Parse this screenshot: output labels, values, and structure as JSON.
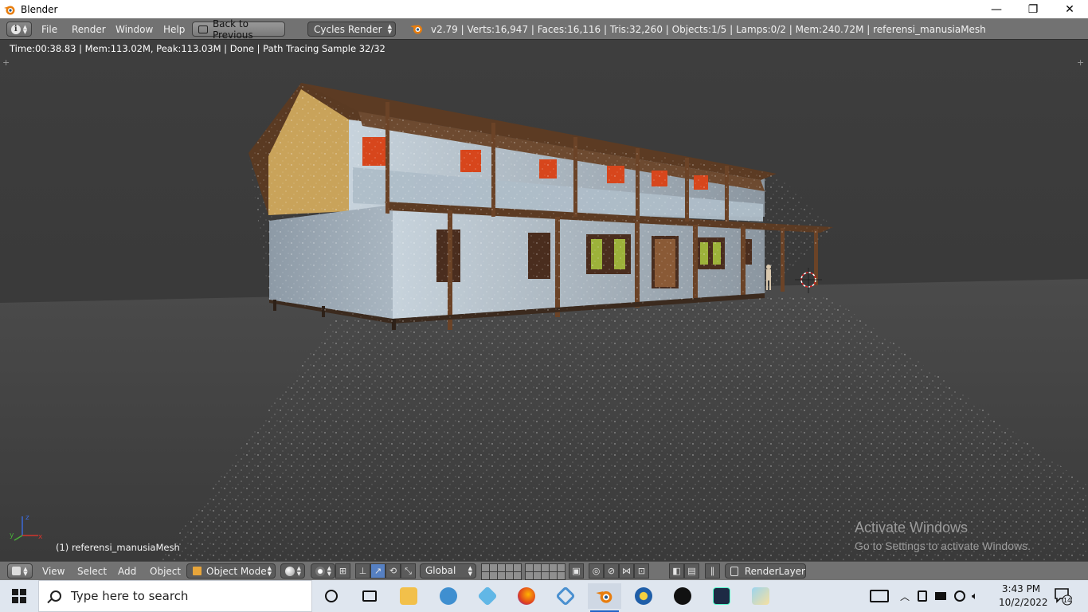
{
  "window": {
    "title": "Blender",
    "min_label": "—",
    "restore_label": "❐",
    "close_label": "✕"
  },
  "info_header": {
    "menu": [
      "File",
      "Render",
      "Window",
      "Help"
    ],
    "back_button": "Back to Previous",
    "render_engine": "Cycles Render",
    "stats": "v2.79 | Verts:16,947 | Faces:16,116 | Tris:32,260 | Objects:1/5 | Lamps:0/2 | Mem:240.72M | referensi_manusiaMesh"
  },
  "render_status": "Time:00:38.83 | Mem:113.02M, Peak:113.03M | Done | Path Tracing Sample 32/32",
  "viewport": {
    "active_object_label": "(1) referensi_manusiaMesh",
    "gizmo_labels": {
      "z": "z",
      "y": "y",
      "x": "x"
    },
    "watermark_title": "Activate Windows",
    "watermark_sub": "Go to Settings to activate Windows."
  },
  "view_header": {
    "menu": [
      "View",
      "Select",
      "Add",
      "Object"
    ],
    "mode": "Object Mode",
    "orientation": "Global",
    "render_layer": "RenderLayer"
  },
  "taskbar": {
    "search_placeholder": "Type here to search",
    "time": "3:43 PM",
    "date": "10/2/2022",
    "notification_count": "14",
    "apps": [
      "cortana-icon",
      "task-view-icon",
      "file-explorer-icon",
      "dolphin-app-icon",
      "snip-app-icon",
      "firefox-icon",
      "sketch-app-icon",
      "blender-icon",
      "media-app-icon",
      "unreal-engine-icon",
      "dark-app-icon",
      "paint-app-icon"
    ]
  },
  "colors": {
    "header_bg": "#727272",
    "viewport_bg": "#3a3a3a",
    "accent_blue": "#5680c2",
    "taskbar_bg": "#dfe6ef"
  }
}
